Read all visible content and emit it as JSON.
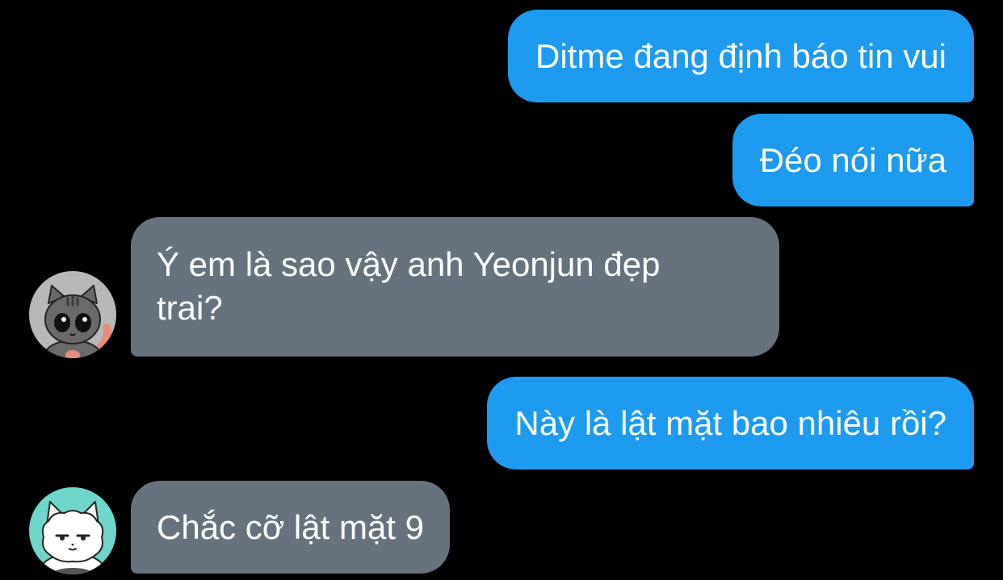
{
  "conversation": {
    "messages": [
      {
        "sender": "me",
        "text": "Ditme đang định báo tin vui"
      },
      {
        "sender": "me",
        "text": "Đéo nói nữa"
      },
      {
        "sender": "other",
        "text_line1": "Ý em là sao vậy anh Yeonjun đẹp",
        "text_line2": "trai?",
        "avatar": "gray-cat-avatar"
      },
      {
        "sender": "me",
        "text": "Này là lật mặt bao nhiêu rồi?"
      },
      {
        "sender": "other",
        "text": "Chắc cỡ lật mặt 9",
        "avatar": "white-cat-avatar"
      }
    ]
  },
  "colors": {
    "background": "#000000",
    "sent_bubble": "#1d9bf0",
    "received_bubble": "#66737f",
    "text": "#ffffff",
    "gray_avatar_bg": "#b8b8b8",
    "white_avatar_bg": "#6fd6cc"
  }
}
